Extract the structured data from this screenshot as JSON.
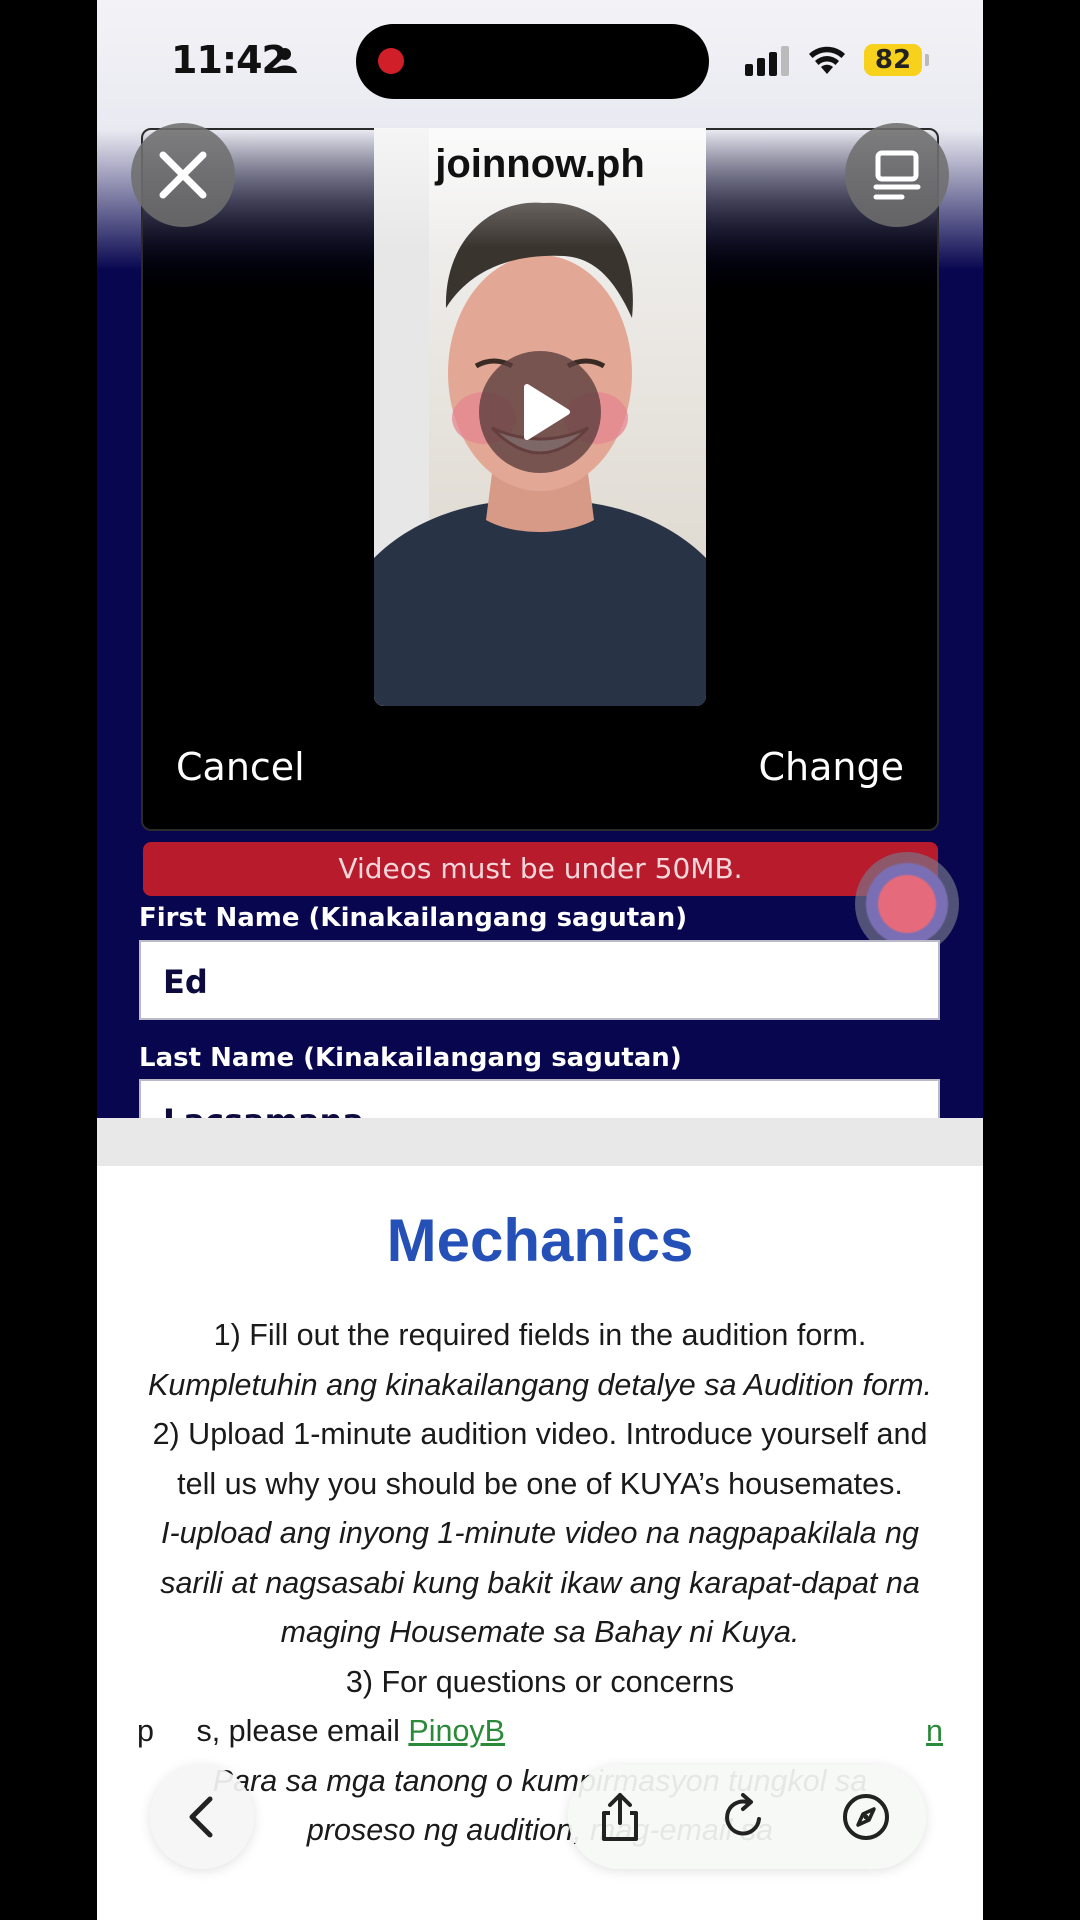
{
  "status_bar": {
    "time": "11:42",
    "battery": "82",
    "icons": [
      "person-icon",
      "recording-dot-icon",
      "signal-icon",
      "wifi-icon",
      "battery-icon"
    ]
  },
  "sheet": {
    "title": "joinnow.ph",
    "close_icon": "close-icon",
    "side_icon": "display-icon",
    "video": {
      "play_icon": "play-icon"
    },
    "cancel_label": "Cancel",
    "change_label": "Change"
  },
  "form": {
    "error_message": "Videos must be under 50MB.",
    "first_name_label": "First Name (Kinakailangang sagutan)",
    "first_name_value": "Ed",
    "last_name_label": "Last Name (Kinakailangang sagutan)",
    "last_name_value": "Lacsamana"
  },
  "article": {
    "title": "Mechanics",
    "step1": "1) Fill out the required fields in the audition form.",
    "step1_tl": "Kumpletuhin ang kinakailangang detalye sa Audition form.",
    "step2": "2) Upload 1-minute audition video. Introduce yourself and tell us why you should be one of KUYA’s housemates.",
    "step2_tl": "I-upload ang inyong 1-minute video na nagpapakilala ng sarili at nagsasabi kung bakit ikaw ang karapat-dapat na maging Housemate sa Bahay ni Kuya.",
    "step3_a": "3) For questions or concerns",
    "step3_b": "p",
    "step3_c": "s, please email",
    "email_fragment": "PinoyB",
    "email_tail": "n",
    "step3_tl": "Para sa mga tanong o kumpirmasyon tungkol sa",
    "step3_tl2": "proseso ng audition, mag-email sa"
  },
  "toolbar": {
    "icons": [
      "back-icon",
      "share-icon",
      "reload-icon",
      "compass-icon"
    ]
  }
}
